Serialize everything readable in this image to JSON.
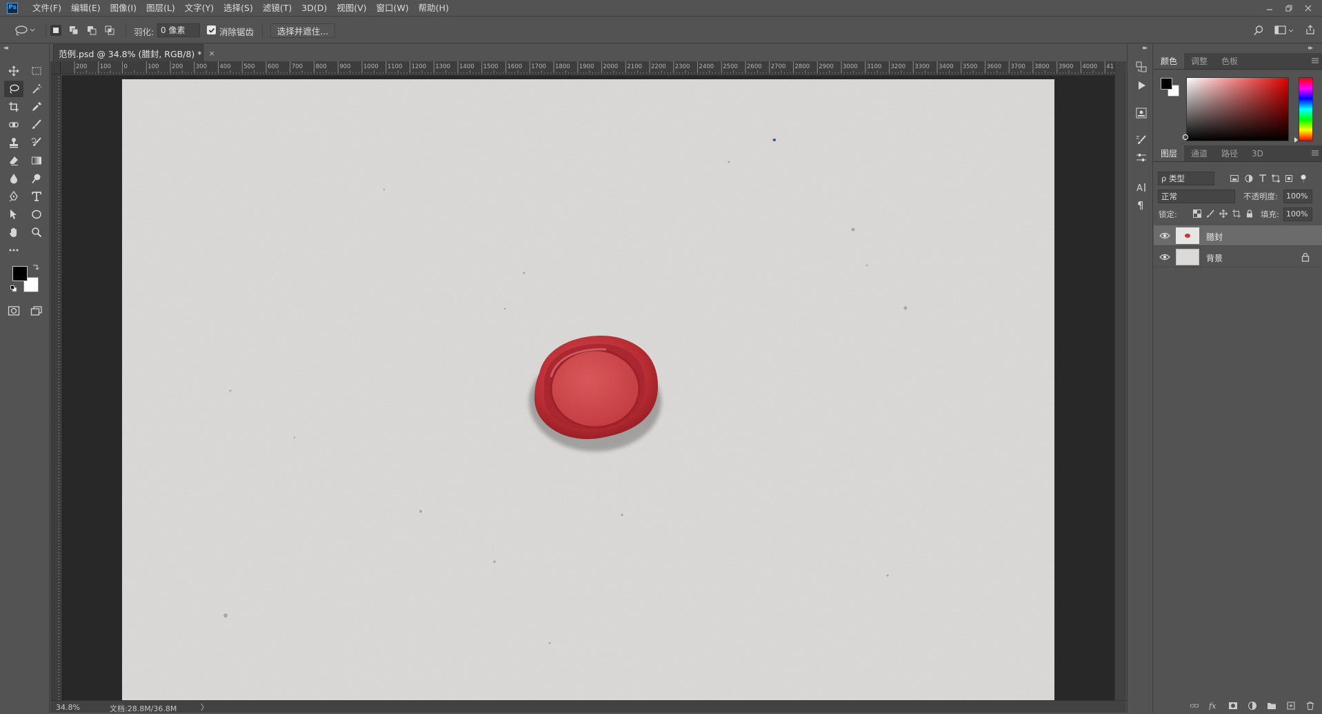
{
  "app": {
    "logo": "Ps"
  },
  "menu": [
    "文件(F)",
    "编辑(E)",
    "图像(I)",
    "图层(L)",
    "文字(Y)",
    "选择(S)",
    "滤镜(T)",
    "3D(D)",
    "视图(V)",
    "窗口(W)",
    "帮助(H)"
  ],
  "options": {
    "feather_label": "羽化:",
    "feather_value": "0 像素",
    "anti_alias_label": "消除锯齿",
    "anti_alias_checked": true,
    "select_mask_label": "选择并遮住..."
  },
  "document": {
    "tab_title": "范例.psd @ 34.8% (腊封, RGB/8) *",
    "close_glyph": "×",
    "zoom": "34.8%",
    "doc_info": "文档:28.8M/36.8M",
    "status_arrow": "〉"
  },
  "ruler": {
    "h_labels": [
      "200",
      "100",
      "0",
      "100",
      "200",
      "300",
      "400",
      "500",
      "600",
      "700",
      "800",
      "900",
      "1000",
      "1100",
      "1200",
      "1300",
      "1400",
      "1500",
      "1600",
      "1700",
      "1800",
      "1900",
      "2000",
      "2100",
      "2200",
      "2300",
      "2400",
      "2500",
      "2600",
      "2700",
      "2800",
      "2900",
      "3000",
      "3100",
      "3200",
      "3300",
      "3400",
      "3500",
      "3600",
      "3700",
      "3800",
      "3900",
      "4000",
      "41"
    ]
  },
  "color_panel": {
    "tabs": [
      "颜色",
      "调整",
      "色板"
    ],
    "active_tab": 0,
    "foreground": "#000000",
    "background": "#ffffff"
  },
  "layers_panel": {
    "tabs": [
      "图层",
      "通道",
      "路径",
      "3D"
    ],
    "active_tab": 0,
    "kind_filter": "ρ 类型",
    "blend_mode": "正常",
    "opacity_label": "不透明度:",
    "opacity_value": "100%",
    "lock_label": "锁定:",
    "fill_label": "填充:",
    "fill_value": "100%",
    "layers": [
      {
        "name": "腊封",
        "visible": true,
        "selected": true,
        "locked": false
      },
      {
        "name": "背景",
        "visible": true,
        "selected": false,
        "locked": true
      }
    ]
  },
  "colors": {
    "ui_bg": "#535353",
    "canvas_bg": "#282828",
    "paper": "#dcdad8",
    "wax_seal": "#c4373b"
  }
}
